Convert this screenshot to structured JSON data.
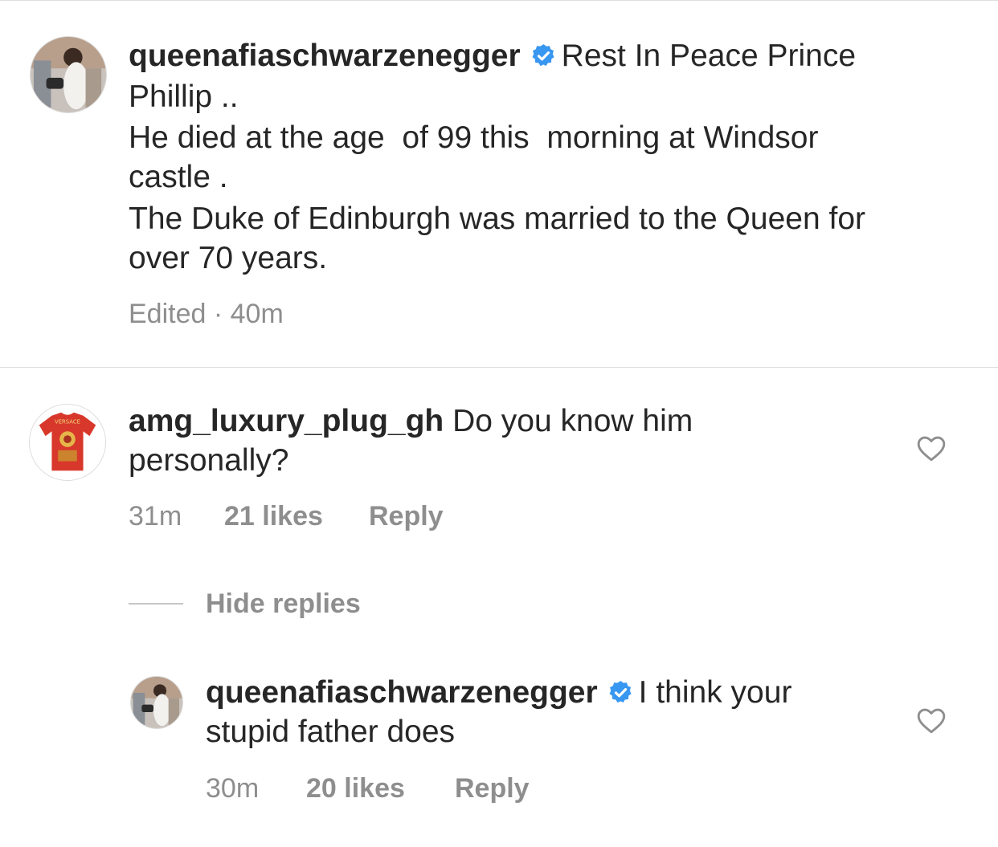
{
  "caption": {
    "username": "queenafiaschwarzenegger",
    "text_line1": "Rest In Peace Prince",
    "text_line2": "Phillip ..",
    "text_line3": "He died at the age  of 99 this  morning at Windsor",
    "text_line4": "castle .",
    "text_line5": "The Duke of Edinburgh was married to the Queen for",
    "text_line6": "over 70 years.",
    "edited_label": "Edited · 40m"
  },
  "comment": {
    "username": "amg_luxury_plug_gh",
    "text_line1": "Do you know him",
    "text_line2": "personally?",
    "avatar_text": "VERSACE",
    "time": "31m",
    "likes": "21 likes",
    "reply_label": "Reply"
  },
  "hide_replies_label": "Hide replies",
  "reply": {
    "username": "queenafiaschwarzenegger",
    "text_line1": "I think your",
    "text_line2": "stupid father does",
    "time": "30m",
    "likes": "20 likes",
    "reply_label": "Reply"
  },
  "colors": {
    "verified_badge": "#3897f0",
    "text_primary": "#262626",
    "text_secondary": "#8e8e8e",
    "divider": "#dbdbdb"
  },
  "icons": {
    "verified": "verified-badge-icon",
    "like": "heart-outline-icon"
  }
}
